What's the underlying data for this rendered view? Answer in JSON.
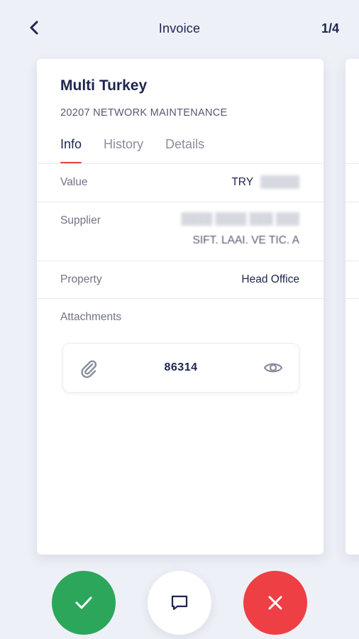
{
  "header": {
    "back_icon": "chevron-left-icon",
    "title": "Invoice",
    "pager": "1/4"
  },
  "invoice": {
    "company": "Multi Turkey",
    "subtitle": "20207 NETWORK MAINTENANCE",
    "tabs": [
      {
        "label": "Info",
        "active": true
      },
      {
        "label": "History",
        "active": false
      },
      {
        "label": "Details",
        "active": false
      }
    ],
    "fields": {
      "value": {
        "label": "Value",
        "currency": "TRY",
        "amount_redacted": "█████"
      },
      "supplier": {
        "label": "Supplier",
        "line1_redacted": "████ ████ ███ ███",
        "line2": "SIFT. LAAI. VE TIC. A"
      },
      "property": {
        "label": "Property",
        "value": "Head Office"
      }
    },
    "attachments": {
      "label": "Attachments",
      "items": [
        {
          "name": "86314",
          "icon": "paperclip-icon",
          "action_icon": "eye-icon"
        }
      ]
    }
  },
  "actions": {
    "approve_icon": "check-icon",
    "comment_icon": "chat-bubble-icon",
    "reject_icon": "close-icon",
    "colors": {
      "approve": "#2ca65a",
      "reject": "#ee3f45",
      "accent": "#e8413f"
    }
  }
}
